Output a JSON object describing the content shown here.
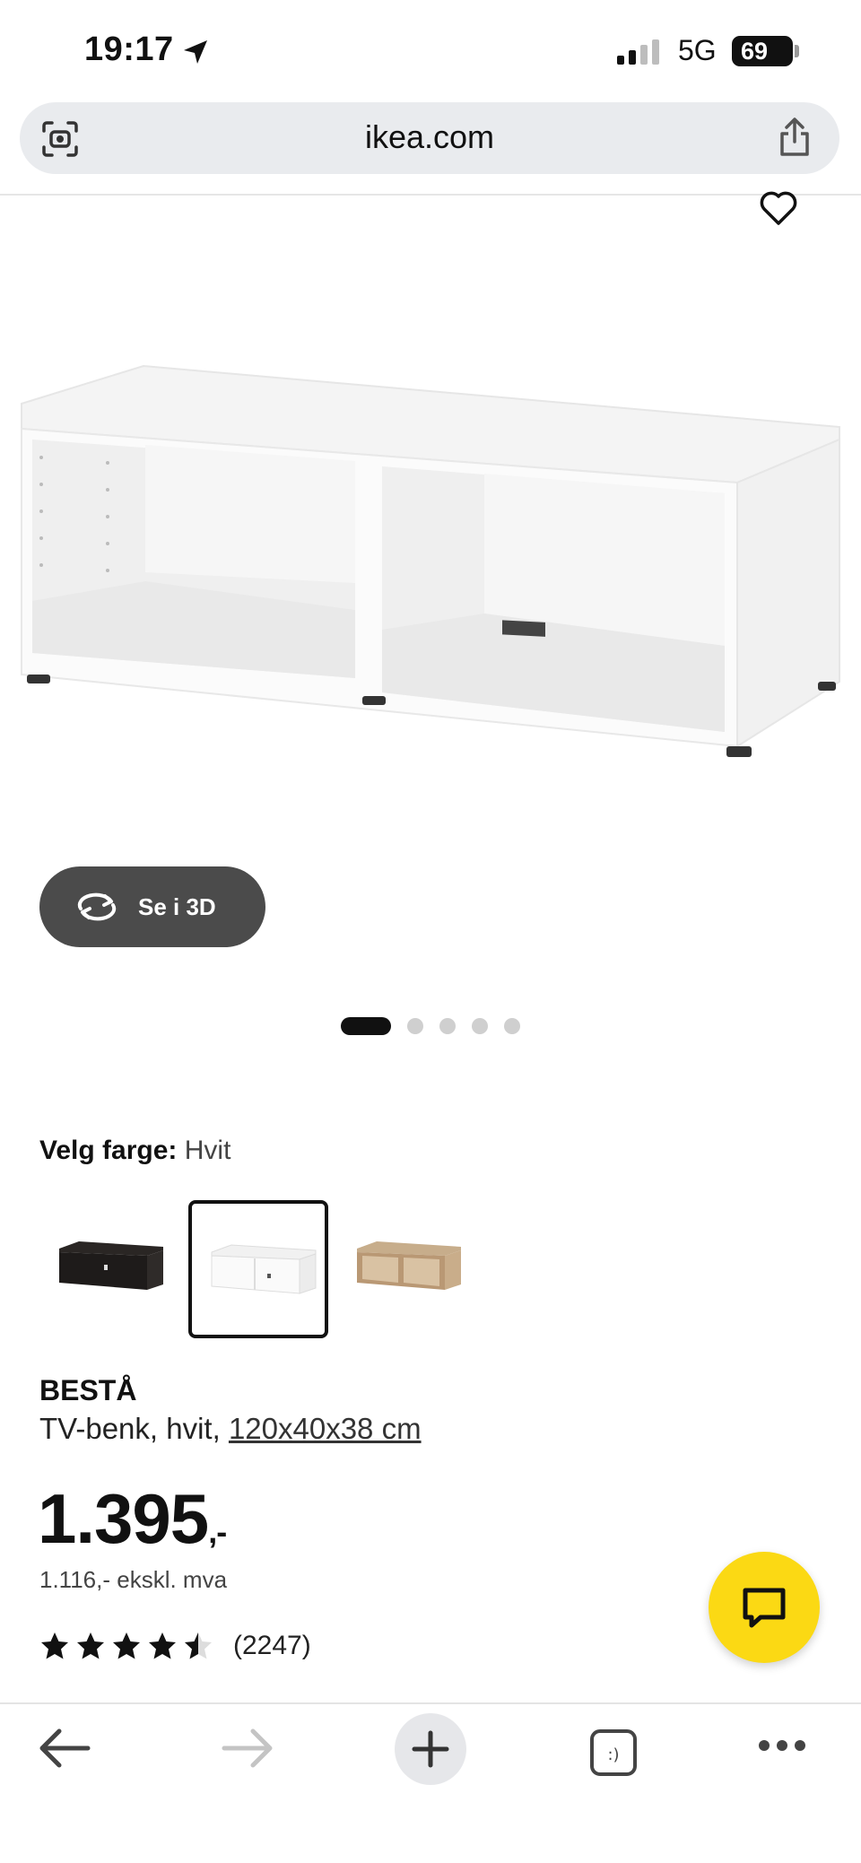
{
  "status_bar": {
    "time": "19:17",
    "network": "5G",
    "battery": "69"
  },
  "browser": {
    "url": "ikea.com"
  },
  "gallery": {
    "view_3d_label": "Se i 3D",
    "slide_count": 5,
    "active_slide": 1
  },
  "color_picker": {
    "label": "Velg farge:",
    "selected": "Hvit",
    "options": [
      "black-brown",
      "white",
      "white-stained-oak"
    ]
  },
  "product": {
    "name": "BESTÅ",
    "description": "TV-benk, hvit, ",
    "dimensions": "120x40x38 cm",
    "price_main": "1.395",
    "price_suffix": ",-",
    "price_ex_vat": "1.116,- ekskl. mva",
    "rating": 4.5,
    "review_count": "(2247)"
  },
  "colors": {
    "accent": "#fbd914",
    "pill": "#4b4b4b",
    "urlbar": "#e9ebee"
  }
}
